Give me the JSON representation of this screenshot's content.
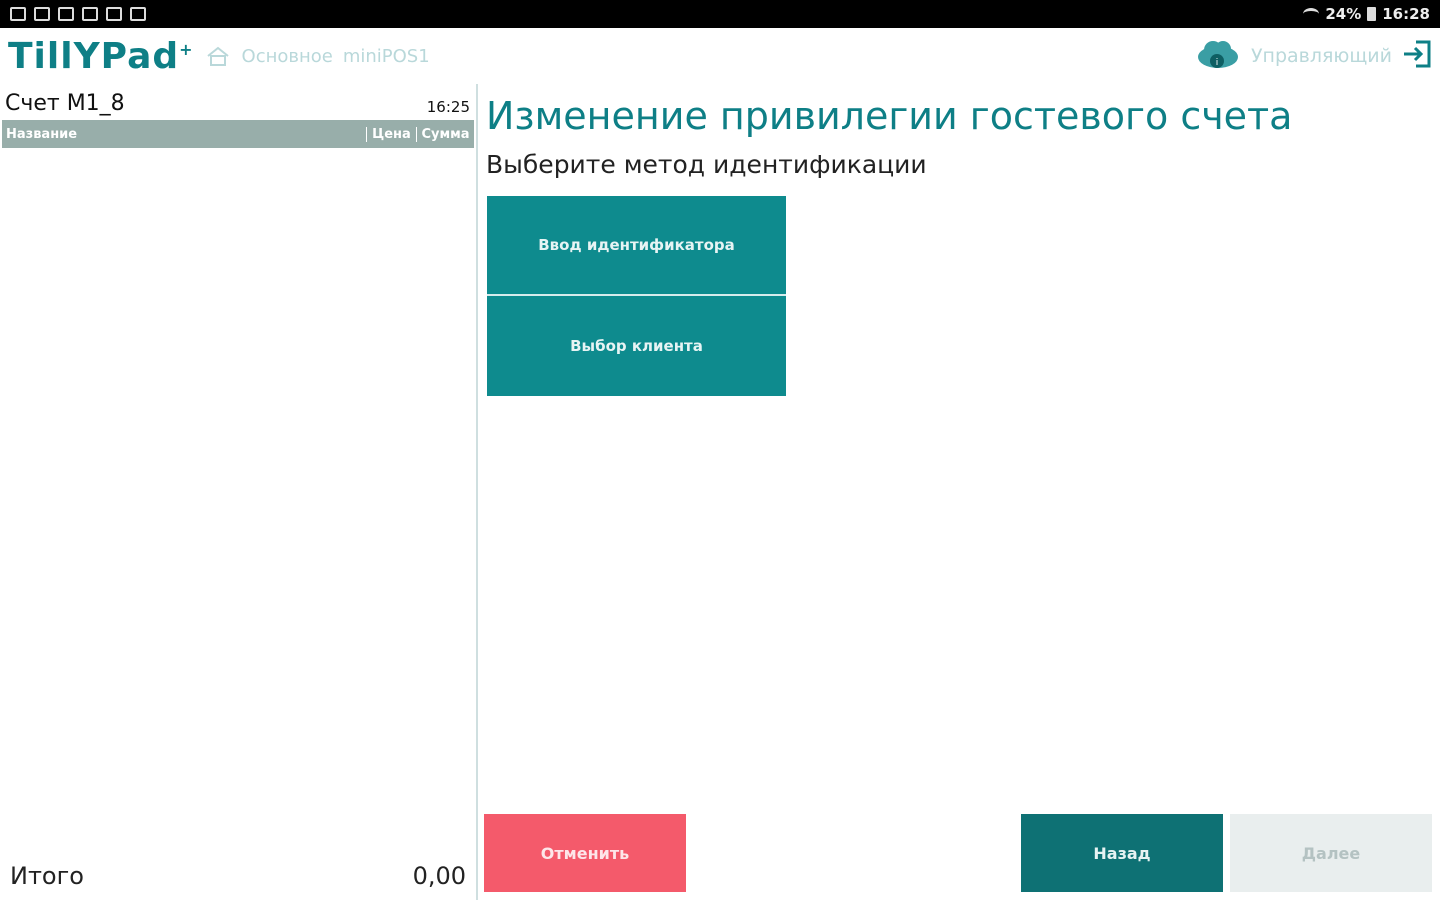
{
  "statusbar": {
    "battery": "24%",
    "time": "16:28",
    "notification_icons": [
      "download-icon",
      "image-icon",
      "pos-icon",
      "pos-icon",
      "pos-icon",
      "image-icon"
    ]
  },
  "appbar": {
    "logo_text": "TillYPad",
    "logo_mark": "+",
    "breadcrumb": [
      "Основное",
      "miniPOS1"
    ],
    "user": "Управляющий"
  },
  "bill": {
    "title": "Счет М1_8",
    "time": "16:25",
    "columns": {
      "name": "Название",
      "price": "Цена",
      "sum": "Сумма"
    },
    "total_label": "Итого",
    "total_value": "0,00"
  },
  "main": {
    "title": "Изменение привилегии гостевого счета",
    "subtitle": "Выберите метод идентификации",
    "methods": [
      "Ввод идентификатора",
      "Выбор клиента"
    ]
  },
  "footer": {
    "cancel": "Отменить",
    "back": "Назад",
    "next": "Далее"
  },
  "colors": {
    "accent": "#0e7f86",
    "cancel": "#f45a6b",
    "disabled": "#e9eeee"
  }
}
